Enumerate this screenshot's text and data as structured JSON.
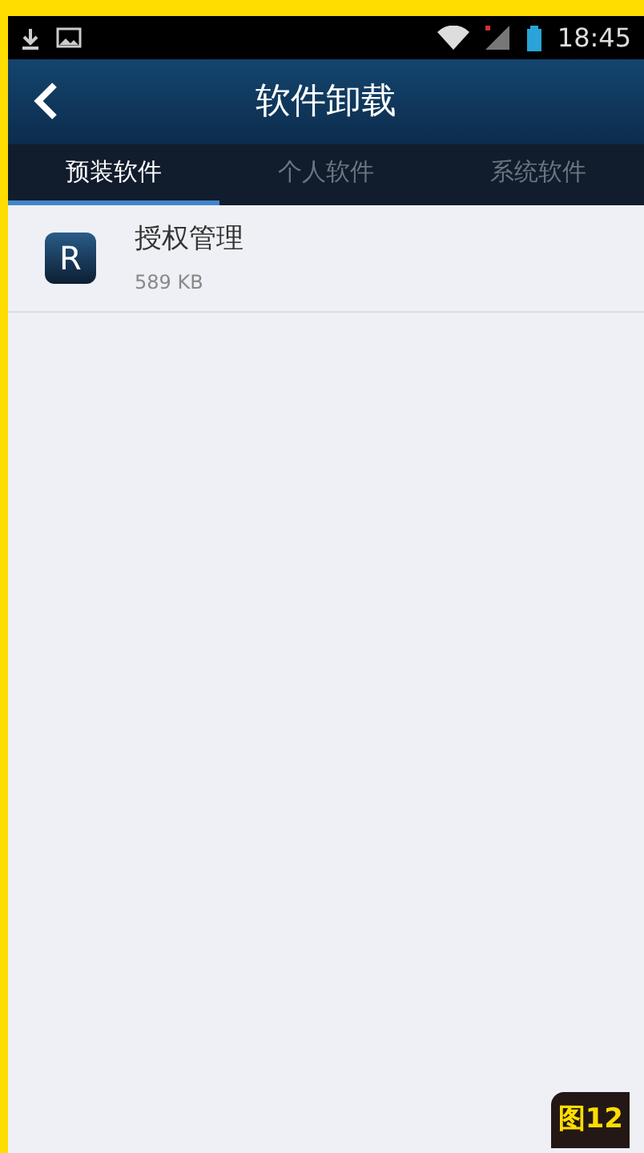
{
  "status_bar": {
    "time": "18:45"
  },
  "header": {
    "title": "软件卸载"
  },
  "tabs": [
    {
      "label": "预装软件",
      "selected": true
    },
    {
      "label": "个人软件",
      "selected": false
    },
    {
      "label": "系统软件",
      "selected": false
    }
  ],
  "apps": [
    {
      "icon_letter": "R",
      "name": "授权管理",
      "size": "589 KB"
    }
  ],
  "figure_label": "图12"
}
